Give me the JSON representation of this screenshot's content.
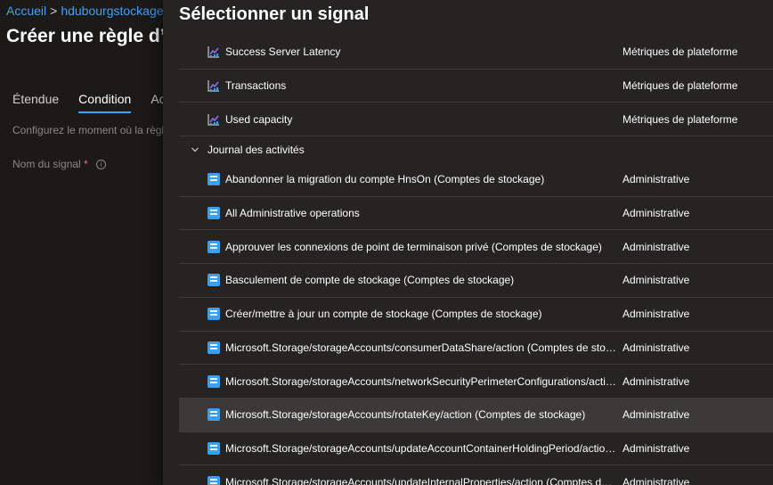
{
  "breadcrumb": {
    "home": "Accueil",
    "resource": "hdubourgstockage | /"
  },
  "page": {
    "title": "Créer une règle d’a",
    "description": "Configurez le moment où la règle",
    "signal_label": "Nom du signal",
    "required_mark": "*",
    "info_glyph": "i"
  },
  "tabs": [
    {
      "label": "Étendue"
    },
    {
      "label": "Condition"
    },
    {
      "label": "Actio"
    }
  ],
  "panel": {
    "title": "Sélectionner un signal",
    "metric_rows": [
      {
        "name": "Success Server Latency",
        "type": "Métriques de plateforme",
        "icon": "metric-chart-icon"
      },
      {
        "name": "Transactions",
        "type": "Métriques de plateforme",
        "icon": "metric-chart-icon"
      },
      {
        "name": "Used capacity",
        "type": "Métriques de plateforme",
        "icon": "metric-chart-icon"
      }
    ],
    "group": {
      "label": "Journal des activités",
      "expanded": true
    },
    "activity_rows": [
      {
        "name": "Abandonner la migration du compte HnsOn (Comptes de stockage)",
        "type": "Administrative",
        "icon": "activity-log-icon"
      },
      {
        "name": "All Administrative operations",
        "type": "Administrative",
        "icon": "activity-log-icon"
      },
      {
        "name": "Approuver les connexions de point de terminaison privé (Comptes de stockage)",
        "type": "Administrative",
        "icon": "activity-log-icon"
      },
      {
        "name": "Basculement de compte de stockage (Comptes de stockage)",
        "type": "Administrative",
        "icon": "activity-log-icon"
      },
      {
        "name": "Créer/mettre à jour un compte de stockage (Comptes de stockage)",
        "type": "Administrative",
        "icon": "activity-log-icon"
      },
      {
        "name": "Microsoft.Storage/storageAccounts/consumerDataShare/action (Comptes de stocka...",
        "type": "Administrative",
        "icon": "activity-log-icon"
      },
      {
        "name": "Microsoft.Storage/storageAccounts/networkSecurityPerimeterConfigurations/action...",
        "type": "Administrative",
        "icon": "activity-log-icon"
      },
      {
        "name": "Microsoft.Storage/storageAccounts/rotateKey/action (Comptes de stockage)",
        "type": "Administrative",
        "icon": "activity-log-icon",
        "selected": true
      },
      {
        "name": "Microsoft.Storage/storageAccounts/updateAccountContainerHoldingPeriod/action (...",
        "type": "Administrative",
        "icon": "activity-log-icon"
      },
      {
        "name": "Microsoft.Storage/storageAccounts/updateInternalProperties/action (Comptes de st...",
        "type": "Administrative",
        "icon": "activity-log-icon"
      }
    ]
  },
  "colors": {
    "accent": "#479ef5",
    "panel_bg": "#252423",
    "page_bg": "#1b1a19",
    "selected_row": "#3b3a39",
    "metric_icon": "#8c6cf0",
    "activity_icon": "#3aa0f3"
  }
}
